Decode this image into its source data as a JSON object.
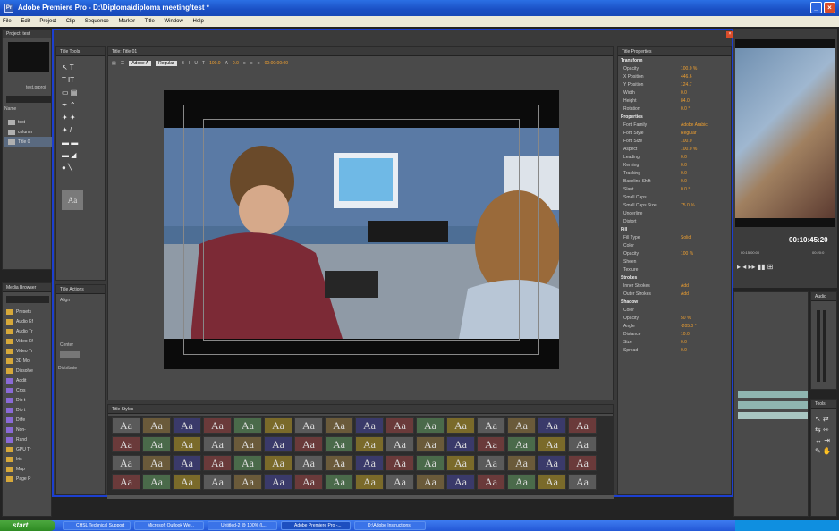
{
  "window": {
    "title": "Adobe Premiere Pro - D:\\Diploma\\diploma meeting\\test *",
    "app_icon": "premiere-icon"
  },
  "menu": [
    "File",
    "Edit",
    "Project",
    "Clip",
    "Sequence",
    "Marker",
    "Title",
    "Window",
    "Help"
  ],
  "project_panel": {
    "tab": "Project: test",
    "file_name": "test.prproj",
    "name_header": "Name",
    "items": [
      "test",
      "column",
      "Title 0"
    ]
  },
  "title_tools": {
    "tab": "Title Tools",
    "sample": "Aa"
  },
  "title_designer": {
    "tab": "Title: Title 01",
    "font_family": "Adobe A",
    "font_style": "Regular",
    "font_size": "100.0",
    "tracking": "0.0",
    "timecode": "00:00:00:00"
  },
  "title_actions": {
    "tab": "Title Actions",
    "align_label": "Align",
    "center_label": "Center",
    "distribute_label": "Distribute"
  },
  "media_browser": {
    "tab": "Media Browser",
    "items": [
      "Presets",
      "Audio Ef",
      "Audio Tr",
      "Video Ef",
      "Video Tr",
      "3D Mo",
      "Dissolve",
      "Addit",
      "Cros",
      "Dip t",
      "Dip t",
      "Diffe",
      "Non-",
      "Rand",
      "GPU Tr",
      "Iris",
      "Map",
      "Page P"
    ]
  },
  "title_properties": {
    "tab": "Title Properties",
    "transform": {
      "label": "Transform",
      "rows": [
        {
          "k": "Opacity",
          "v": "100.0 %"
        },
        {
          "k": "X Position",
          "v": "446.6"
        },
        {
          "k": "Y Position",
          "v": "124.7"
        },
        {
          "k": "Width",
          "v": "0.0"
        },
        {
          "k": "Height",
          "v": "84.0"
        },
        {
          "k": "Rotation",
          "v": "0.0 °"
        }
      ]
    },
    "properties": {
      "label": "Properties",
      "rows": [
        {
          "k": "Font Family",
          "v": "Adobe Arabic"
        },
        {
          "k": "Font Style",
          "v": "Regular"
        },
        {
          "k": "Font Size",
          "v": "100.0"
        },
        {
          "k": "Aspect",
          "v": "100.0 %"
        },
        {
          "k": "Leading",
          "v": "0.0"
        },
        {
          "k": "Kerning",
          "v": "0.0"
        },
        {
          "k": "Tracking",
          "v": "0.0"
        },
        {
          "k": "Baseline Shift",
          "v": "0.0"
        },
        {
          "k": "Slant",
          "v": "0.0 °"
        },
        {
          "k": "Small Caps",
          "v": ""
        },
        {
          "k": "Small Caps Size",
          "v": "75.0 %"
        },
        {
          "k": "Underline",
          "v": ""
        },
        {
          "k": "Distort",
          "v": ""
        }
      ]
    },
    "fill": {
      "label": "Fill",
      "rows": [
        {
          "k": "Fill Type",
          "v": "Solid"
        },
        {
          "k": "Color",
          "v": ""
        },
        {
          "k": "Opacity",
          "v": "100 %"
        },
        {
          "k": "Sheen",
          "v": ""
        },
        {
          "k": "Texture",
          "v": ""
        }
      ]
    },
    "strokes": {
      "label": "Strokes",
      "rows": [
        {
          "k": "Inner Strokes",
          "v": "Add"
        },
        {
          "k": "Outer Strokes",
          "v": "Add"
        }
      ]
    },
    "shadow": {
      "label": "Shadow",
      "rows": [
        {
          "k": "Color",
          "v": ""
        },
        {
          "k": "Opacity",
          "v": "50 %"
        },
        {
          "k": "Angle",
          "v": "-205.0 °"
        },
        {
          "k": "Distance",
          "v": "10.0"
        },
        {
          "k": "Size",
          "v": "0.0"
        },
        {
          "k": "Spread",
          "v": "0.0"
        }
      ]
    }
  },
  "title_styles": {
    "tab": "Title Styles"
  },
  "program_monitor": {
    "timecode": "00:10:45:20",
    "ruler_a": "00:15:00:00",
    "ruler_b": "00:20:0"
  },
  "audio_panel": {
    "tab": "Audio"
  },
  "tools_panel": {
    "tab": "Tools"
  },
  "taskbar": {
    "start": "start",
    "tasks": [
      "CHSL Technical Support",
      "Microsoft Outlook We...",
      "Untitled-2 @ 100% (L...",
      "Adobe Premiere Pro -...",
      "D:\\Adobe Instructions"
    ]
  }
}
